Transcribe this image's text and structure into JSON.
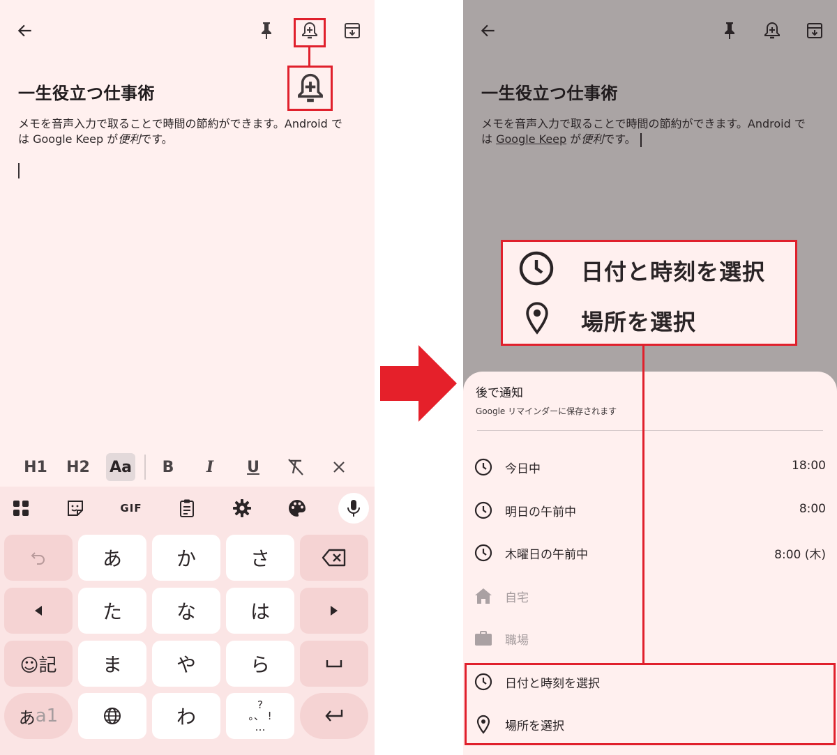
{
  "left_screen": {
    "note": {
      "title": "一生役立つ仕事術",
      "body_line1": "メモを音声入力で取ることで時間の節約ができます。Android で",
      "body_line2_pre": "は Google Keep が",
      "body_line2_em": "便利",
      "body_line2_post": "です。"
    },
    "format_bar": {
      "h1": "H1",
      "h2": "H2",
      "aa": "Aa",
      "bold": "B",
      "italic": "I",
      "underline": "U"
    },
    "keyboard": {
      "gif_label": "GIF",
      "kana_keys": [
        "あ",
        "か",
        "さ",
        "た",
        "な",
        "は",
        "ま",
        "や",
        "ら",
        "わ"
      ],
      "emoji_kigou": "☺記",
      "mode_toggle_a": "あ",
      "mode_toggle_b": "a1",
      "punct_top": "?",
      "punct_mid": "。、 !",
      "punct_bottom": "…"
    }
  },
  "right_screen": {
    "note": {
      "title": "一生役立つ仕事術",
      "body_line1": "メモを音声入力で取ることで時間の節約ができます。Android で",
      "body_line2_pre": "は",
      "body_link": "Google Keep",
      "body_line2_mid": "が",
      "body_line2_em": "便利",
      "body_line2_post": "です。"
    },
    "sheet": {
      "title": "後で通知",
      "subtitle": "Google リマインダーに保存されます",
      "options": [
        {
          "label": "今日中",
          "time": "18:00",
          "icon": "clock-icon"
        },
        {
          "label": "明日の午前中",
          "time": "8:00",
          "icon": "clock-icon"
        },
        {
          "label": "木曜日の午前中",
          "time": "8:00 (木)",
          "icon": "clock-icon"
        },
        {
          "label": "自宅",
          "time": "",
          "icon": "home-icon",
          "disabled": true
        },
        {
          "label": "職場",
          "time": "",
          "icon": "briefcase-icon",
          "disabled": true
        },
        {
          "label": "日付と時刻を選択",
          "time": "",
          "icon": "clock-icon"
        },
        {
          "label": "場所を選択",
          "time": "",
          "icon": "location-pin-icon"
        }
      ]
    },
    "callout": {
      "item1": "日付と時刻を選択",
      "item2": "場所を選択"
    }
  },
  "colors": {
    "highlight_red": "#e0202c",
    "app_background": "#fff0ef",
    "scrim_gray": "#aaa4a4",
    "keyboard_background": "#fbe5e5",
    "key_pink": "#f5d3d3",
    "arrow_red": "#e5202a"
  }
}
